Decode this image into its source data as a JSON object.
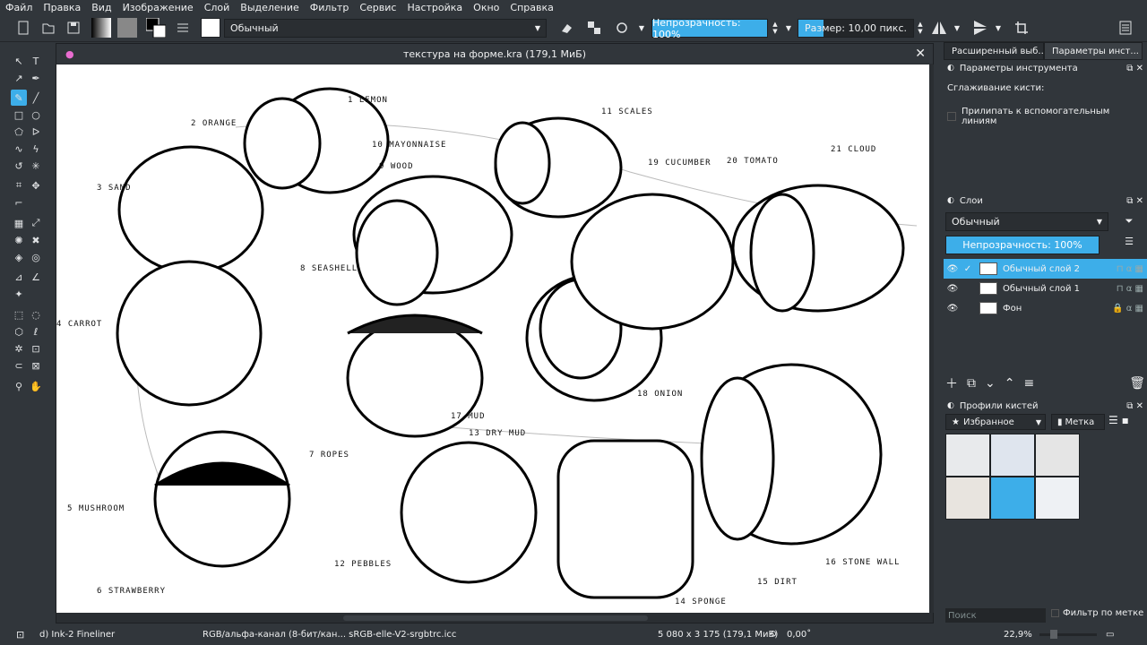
{
  "menu": [
    "Файл",
    "Правка",
    "Вид",
    "Изображение",
    "Слой",
    "Выделение",
    "Фильтр",
    "Сервис",
    "Настройка",
    "Окно",
    "Справка"
  ],
  "toolbar": {
    "blend_mode": "Обычный",
    "opacity": "Непрозрачность: 100%",
    "size": "Размер: 10,00 пикс."
  },
  "document": {
    "title": "текстура на форме.kra (179,1 МиБ)"
  },
  "dock": {
    "tabs": [
      "Расширенный выб...",
      "Параметры инст..."
    ],
    "tool_options_title": "Параметры инструмента",
    "smoothing_label": "Сглаживание кисти:",
    "snap_label": "Прилипать к вспомогательным линиям",
    "layers_title": "Слои",
    "layers_blend": "Обычный",
    "layers_opacity": "Непрозрачность:  100%",
    "layers": [
      {
        "name": "Обычный слой 2",
        "active": true
      },
      {
        "name": "Обычный слой 1",
        "active": false
      },
      {
        "name": "Фон",
        "active": false
      }
    ],
    "brush_presets_title": "Профили кистей",
    "brush_filter": "Избранное",
    "brush_tag": "Метка",
    "search_placeholder": "Поиск",
    "filter_by_tag": "Фильтр по метке"
  },
  "status": {
    "brush": "d) Ink-2 Fineliner",
    "colorspace": "RGB/альфа-канал (8-бит/кан...  sRGB-elle-V2-srgbtrc.icc",
    "dimensions": "5 080 x 3 175 (179,1 МиБ)",
    "rotation": "0,00˚",
    "zoom": "22,9%"
  },
  "canvas_labels": [
    "1 LEMON",
    "2 ORANGE",
    "3 SAND",
    "4 CARROT",
    "5 MUSHROOM",
    "6 STRAWBERRY",
    "7 ROPES",
    "8 SEASHELL",
    "9 WOOD",
    "10 MAYONNAISE",
    "11 SCALES",
    "12 PEBBLES",
    "13 DRY MUD",
    "14 SPONGE",
    "15 DIRT",
    "16 STONE WALL",
    "17 MUD",
    "18 ONION",
    "19 CUCUMBER",
    "20 TOMATO",
    "21 CLOUD"
  ],
  "colors": {
    "accent": "#3daee9",
    "panel": "#31363b",
    "dark": "#232629"
  }
}
